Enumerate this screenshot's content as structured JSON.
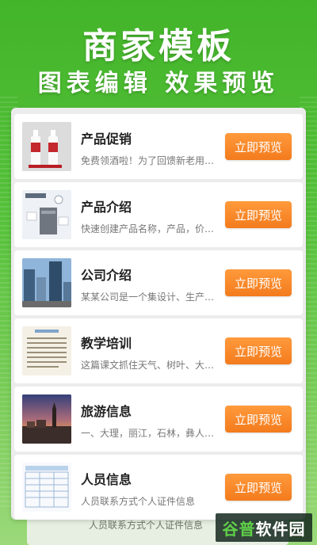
{
  "header": {
    "title": "商家模板",
    "subtitle": "图表编辑 效果预览"
  },
  "templates": [
    {
      "title": "产品促销",
      "desc": "免费领酒啦！为了回馈新老用…",
      "button": "立即预览",
      "thumb": "wine-bottles"
    },
    {
      "title": "产品介绍",
      "desc": "快速创建产品名称，产品，价…",
      "button": "立即预览",
      "thumb": "product-device"
    },
    {
      "title": "公司介绍",
      "desc": "某某公司是一个集设计、生产…",
      "button": "立即预览",
      "thumb": "office-buildings"
    },
    {
      "title": "教学培训",
      "desc": "这篇课文抓住天气、树叶、大…",
      "button": "立即预览",
      "thumb": "lesson-page"
    },
    {
      "title": "旅游信息",
      "desc": "一、大理，丽江，石林，彝人…",
      "button": "立即预览",
      "thumb": "city-sunset"
    },
    {
      "title": "人员信息",
      "desc": "人员联系方式个人证件信息",
      "button": "立即预览",
      "thumb": "form-table"
    }
  ],
  "peek": {
    "text": "人员联系方式个人证件信息"
  },
  "watermark": {
    "text_a": "谷普",
    "text_b": "软件园"
  },
  "colors": {
    "accent": "#f37b1d",
    "background": "#4cbb30"
  }
}
